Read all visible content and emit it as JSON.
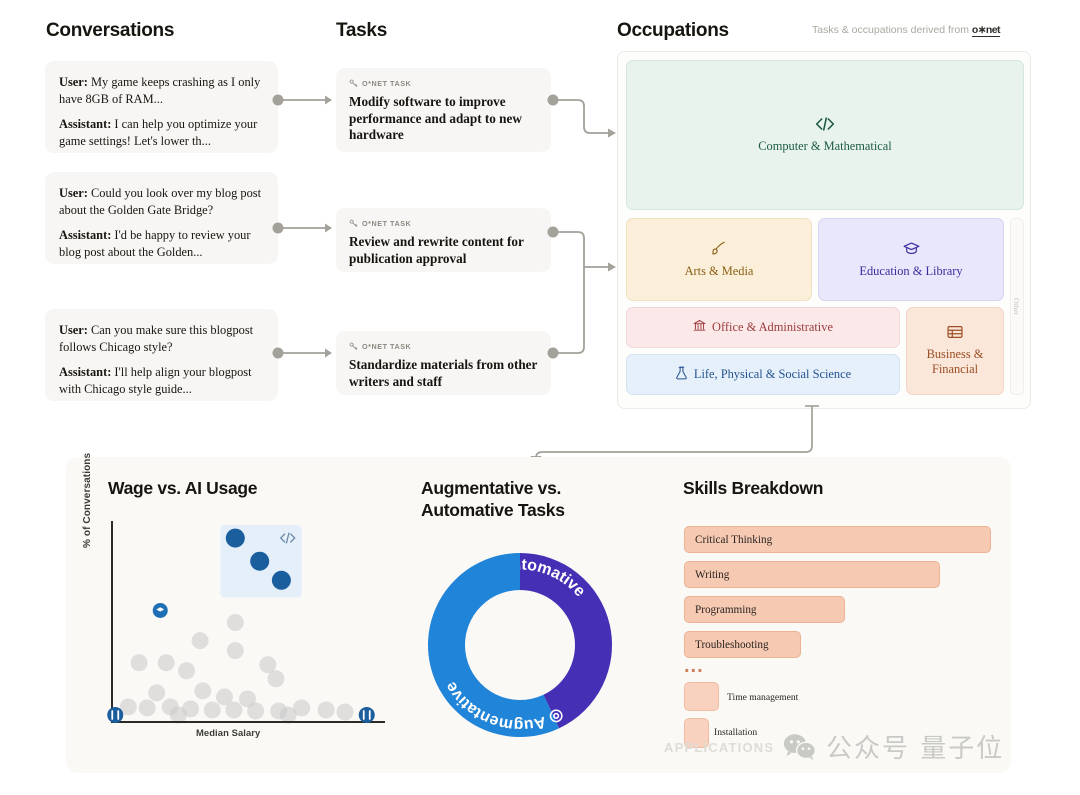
{
  "columns": {
    "conversations_title": "Conversations",
    "tasks_title": "Tasks",
    "occupations_title": "Occupations"
  },
  "derived_note": {
    "text": "Tasks & occupations derived from",
    "source": "o∗net"
  },
  "conversations": [
    {
      "user_label": "User:",
      "user_text": " My game keeps crashing as I only have 8GB of RAM...",
      "assistant_label": "Assistant:",
      "assistant_text": " I can help you optimize your game settings! Let's lower th..."
    },
    {
      "user_label": "User:",
      "user_text": "  Could you look over my blog post about the Golden Gate Bridge?",
      "assistant_label": "Assistant:",
      "assistant_text": " I'd be happy to review your blog post about the Golden..."
    },
    {
      "user_label": "User:",
      "user_text": " Can you make sure this blogpost follows Chicago style?",
      "assistant_label": "Assistant:",
      "assistant_text": " I'll help align your blogpost with Chicago style guide..."
    }
  ],
  "tasks": [
    {
      "tag": "O*NET TASK",
      "text": "Modify software to improve performance and adapt to new hardware"
    },
    {
      "tag": "O*NET TASK",
      "text": "Review and rewrite content for publication approval"
    },
    {
      "tag": "O*NET TASK",
      "text": "Standardize materials from other writers and staff"
    }
  ],
  "occupations": [
    {
      "label": "Computer & Mathematical",
      "icon": "code-icon",
      "color": "#e7f3ec",
      "text_color": "#1e5c43"
    },
    {
      "label": "Arts & Media",
      "icon": "paintbrush-icon",
      "color": "#fbefd9",
      "text_color": "#8a6118"
    },
    {
      "label": "Education & Library",
      "icon": "graduation-cap-icon",
      "color": "#e8e7fb",
      "text_color": "#3a2e9e"
    },
    {
      "label": "Office & Administrative",
      "icon": "bank-icon",
      "color": "#fbe9e9",
      "text_color": "#9c3b3b"
    },
    {
      "label": "Life, Physical & Social Science",
      "icon": "flask-icon",
      "color": "#e6f0fb",
      "text_color": "#24538f"
    },
    {
      "label": "Business & Financial",
      "icon": "table-icon",
      "color": "#fbe6da",
      "text_color": "#9b4f24"
    },
    {
      "label": "Other",
      "icon": "none",
      "color": "#fbfaf8",
      "text_color": "#c8c6c0"
    }
  ],
  "applications": {
    "section_label": "APPLICATIONS",
    "charts": [
      {
        "title": "Wage vs. AI Usage"
      },
      {
        "title": "Augmentative vs. Automative Tasks"
      },
      {
        "title": "Skills Breakdown"
      }
    ]
  },
  "watermark": {
    "text": "公众号 量子位"
  },
  "chart_data": [
    {
      "type": "scatter",
      "title": "Wage vs. AI Usage",
      "xlabel": "Median Salary",
      "ylabel": "% of Conversations",
      "grid": false,
      "legend": "none",
      "highlight_box": {
        "label": "code-icon",
        "x": [
          0.4,
          0.7
        ],
        "y": [
          0.62,
          0.98
        ]
      },
      "series": [
        {
          "name": "Highlighted (Computer & Mathematical)",
          "color": "#1b5e9e",
          "points": [
            {
              "x": 0.455,
              "y": 0.915
            },
            {
              "x": 0.545,
              "y": 0.8
            },
            {
              "x": 0.625,
              "y": 0.705
            }
          ]
        },
        {
          "name": "Education & Library marker",
          "color": "#1f6fb5",
          "points": [
            {
              "x": 0.178,
              "y": 0.555
            }
          ]
        },
        {
          "name": "Other occupations",
          "color": "#c9c9c9",
          "points": [
            {
              "x": 0.455,
              "y": 0.495
            },
            {
              "x": 0.325,
              "y": 0.405
            },
            {
              "x": 0.455,
              "y": 0.355
            },
            {
              "x": 0.1,
              "y": 0.295
            },
            {
              "x": 0.2,
              "y": 0.295
            },
            {
              "x": 0.275,
              "y": 0.255
            },
            {
              "x": 0.575,
              "y": 0.285
            },
            {
              "x": 0.605,
              "y": 0.215
            },
            {
              "x": 0.165,
              "y": 0.145
            },
            {
              "x": 0.335,
              "y": 0.155
            },
            {
              "x": 0.415,
              "y": 0.125
            },
            {
              "x": 0.5,
              "y": 0.115
            },
            {
              "x": 0.06,
              "y": 0.075
            },
            {
              "x": 0.13,
              "y": 0.07
            },
            {
              "x": 0.215,
              "y": 0.075
            },
            {
              "x": 0.29,
              "y": 0.065
            },
            {
              "x": 0.37,
              "y": 0.06
            },
            {
              "x": 0.45,
              "y": 0.06
            },
            {
              "x": 0.53,
              "y": 0.055
            },
            {
              "x": 0.615,
              "y": 0.055
            },
            {
              "x": 0.7,
              "y": 0.07
            },
            {
              "x": 0.79,
              "y": 0.06
            },
            {
              "x": 0.86,
              "y": 0.05
            },
            {
              "x": 0.245,
              "y": 0.035
            },
            {
              "x": 0.65,
              "y": 0.035
            }
          ]
        }
      ],
      "axis_markers": [
        {
          "name": "food-service-icon",
          "x": 0.012,
          "y": 0.035,
          "color": "#1b5e9e"
        },
        {
          "name": "wrench-icon",
          "x": 0.94,
          "y": 0.035,
          "color": "#1b5e9e"
        }
      ]
    },
    {
      "type": "pie",
      "variant": "donut",
      "title": "Augmentative vs. Automative Tasks",
      "labels": [
        "Automative",
        "Augmentative"
      ],
      "values": [
        43,
        57
      ],
      "colors": [
        "#4530b5",
        "#2084d8"
      ],
      "legend": "on-slice"
    },
    {
      "type": "bar",
      "orientation": "horizontal",
      "title": "Skills Breakdown",
      "categories": [
        "Critical Thinking",
        "Writing",
        "Programming",
        "Troubleshooting"
      ],
      "values": [
        100,
        83,
        53,
        37
      ],
      "ylim": [
        0,
        100
      ],
      "bar_color": "#f6c9b3",
      "truncated_indicator": "...",
      "extra_items": [
        {
          "label": "Time management",
          "value": 12
        },
        {
          "label": "Installation",
          "value": 9
        }
      ]
    }
  ]
}
